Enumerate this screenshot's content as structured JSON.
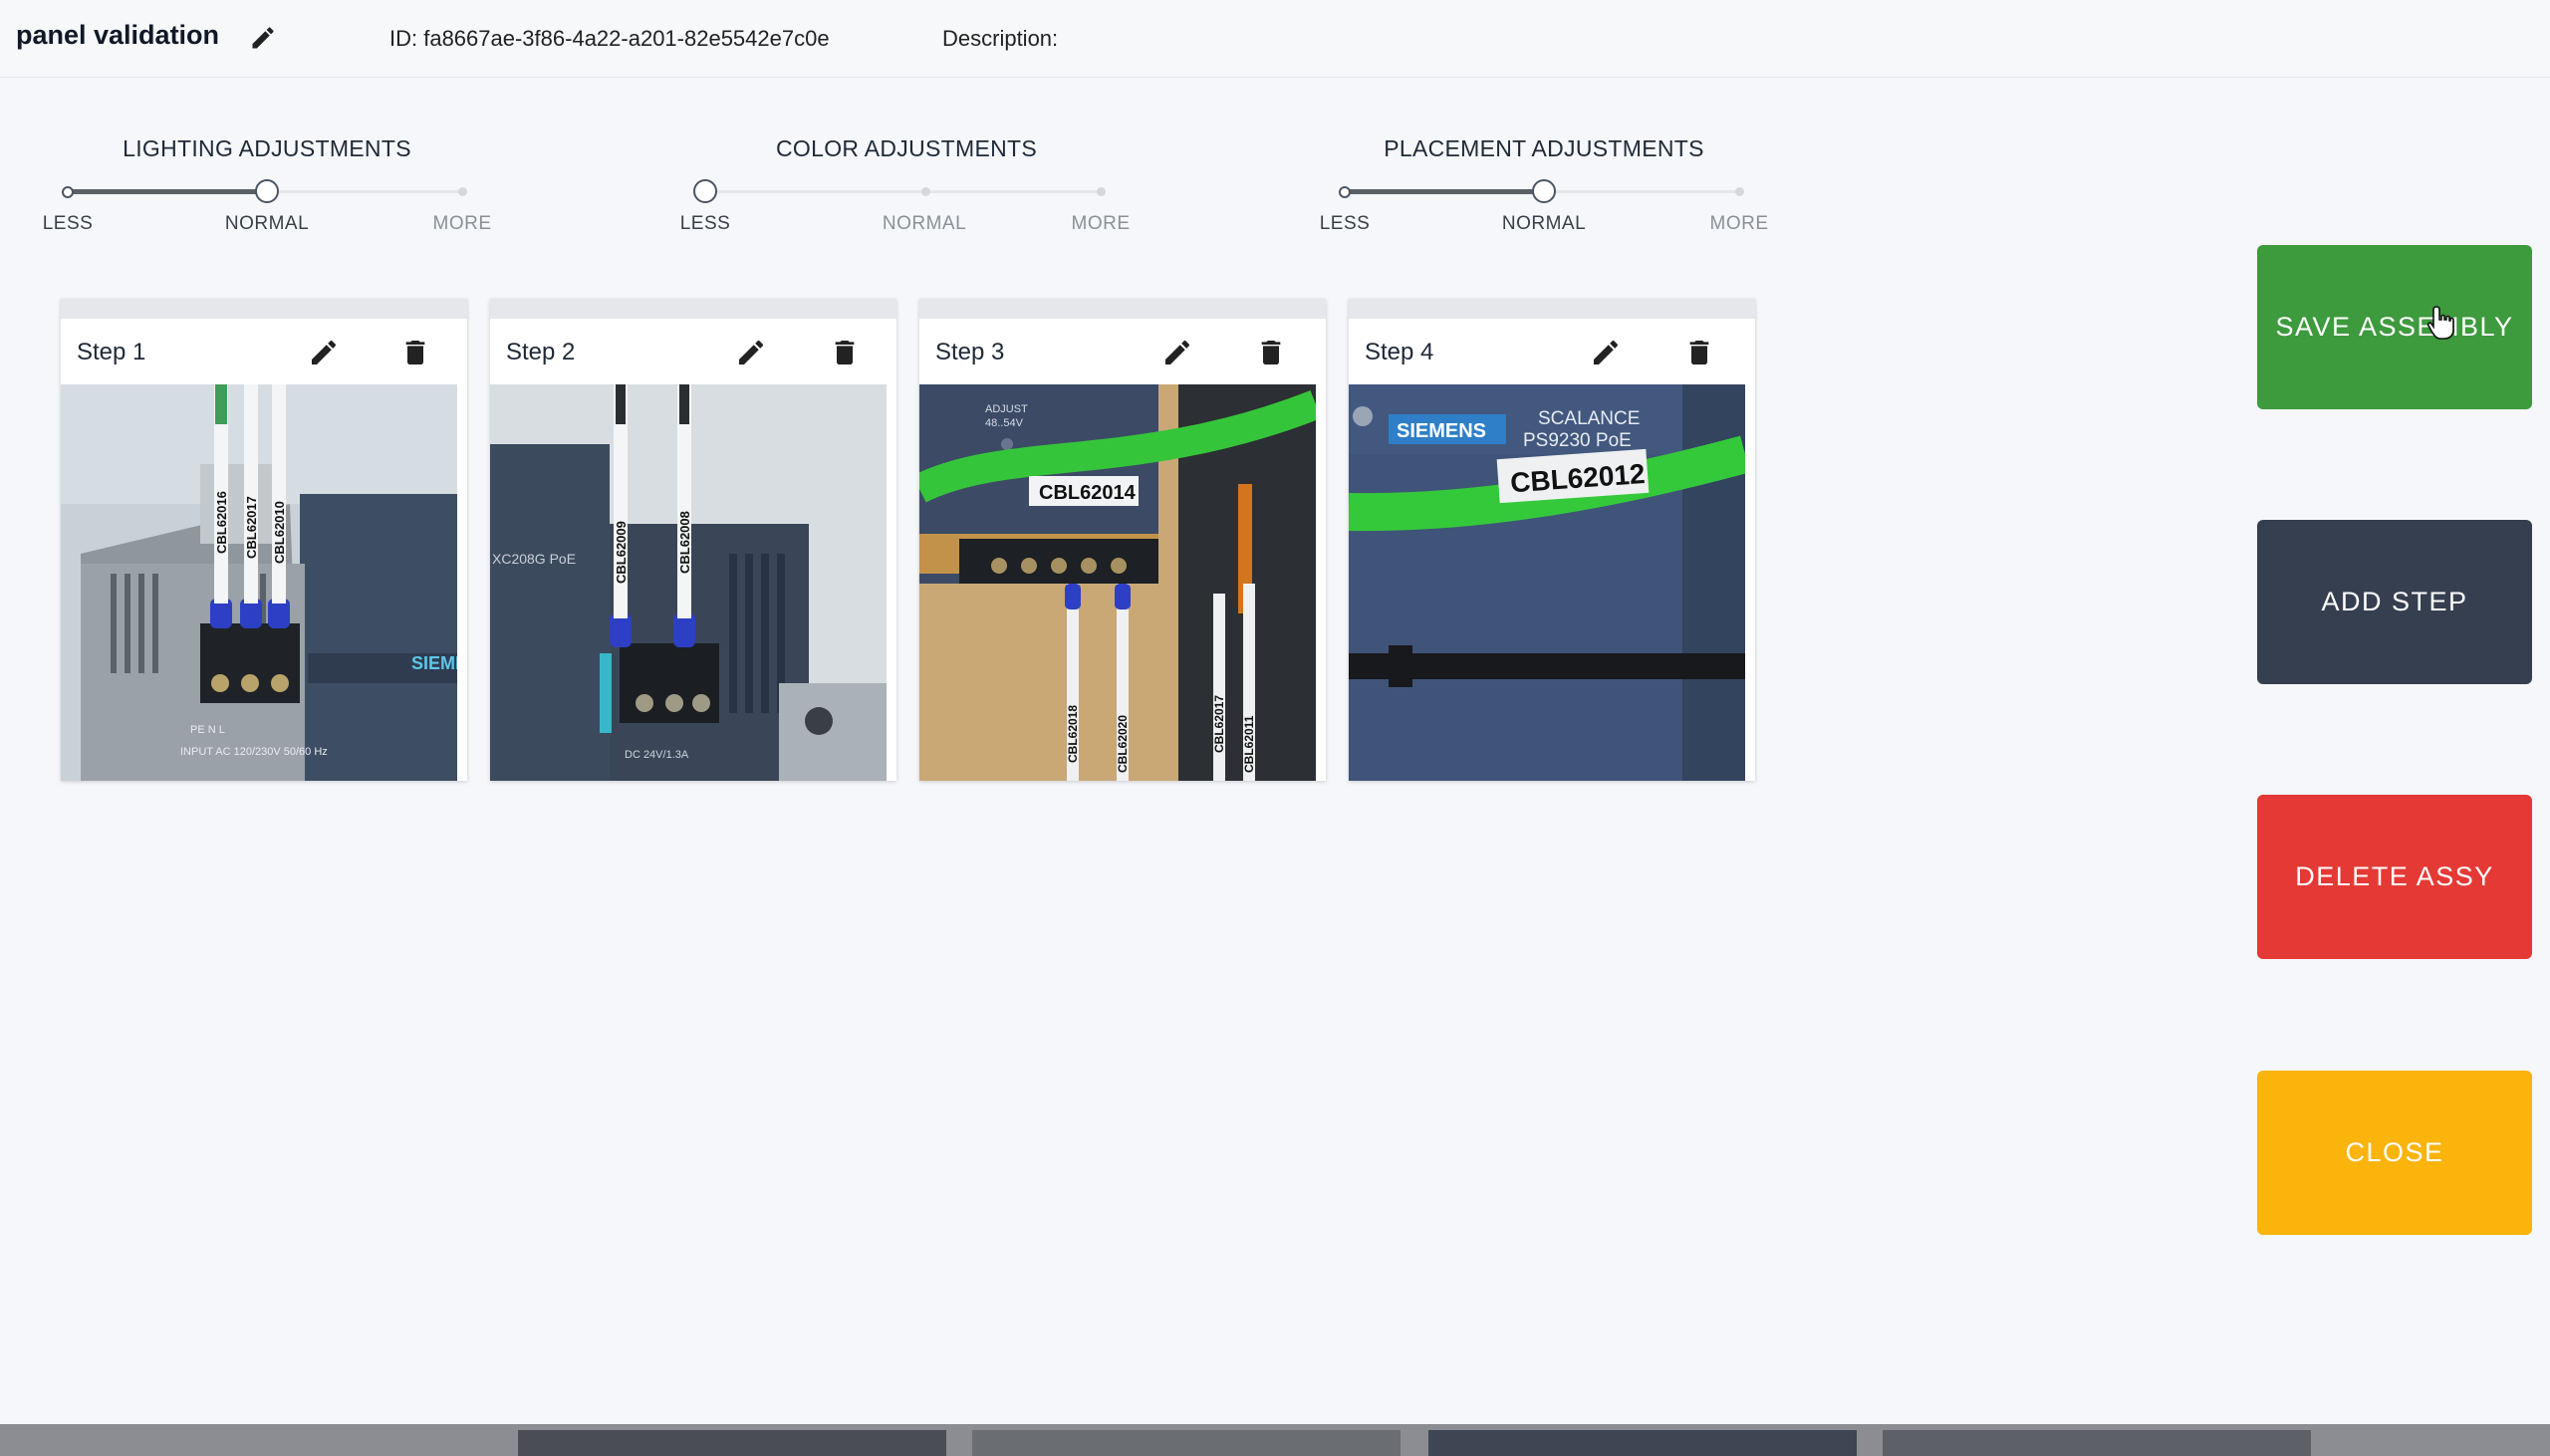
{
  "header": {
    "title": "panel validation",
    "id_text": "ID: fa8667ae-3f86-4a22-a201-82e5542e7c0e",
    "description_label": "Description:"
  },
  "adjustments": [
    {
      "title": "LIGHTING ADJUSTMENTS",
      "level": "NORMAL",
      "labels": [
        "LESS",
        "NORMAL",
        "MORE"
      ]
    },
    {
      "title": "COLOR ADJUSTMENTS",
      "level": "LESS",
      "labels": [
        "LESS",
        "NORMAL",
        "MORE"
      ]
    },
    {
      "title": "PLACEMENT ADJUSTMENTS",
      "level": "NORMAL",
      "labels": [
        "LESS",
        "NORMAL",
        "MORE"
      ]
    }
  ],
  "steps": [
    {
      "label": "Step 1",
      "cable_labels": [
        "CBL62016",
        "CBL62017",
        "CBL62010"
      ],
      "photo_text": [
        "INPUT AC 120/230V 50/60 Hz",
        "PE  N  L",
        "SIEME"
      ]
    },
    {
      "label": "Step 2",
      "cable_labels": [
        "CBL62009",
        "CBL62008"
      ],
      "photo_text": [
        "XC208G PoE",
        "DC 24V/1.3A"
      ]
    },
    {
      "label": "Step 3",
      "cable_labels": [
        "CBL62014",
        "CBL62018",
        "CBL62020",
        "CBL62017",
        "CBL62011"
      ],
      "photo_text": [
        "ADJUST",
        "48..54V"
      ]
    },
    {
      "label": "Step 4",
      "cable_labels": [
        "CBL62012"
      ],
      "photo_text": [
        "SIEMENS",
        "SCALANCE",
        "PS9230 PoE"
      ]
    }
  ],
  "buttons": {
    "save": "SAVE ASSEMBLY",
    "add_step": "ADD STEP",
    "delete": "DELETE ASSY",
    "close": "CLOSE"
  },
  "colors": {
    "save": "#3d9a3d",
    "add_step": "#353f50",
    "delete": "#e53935",
    "close": "#fbb40c"
  },
  "icons": {
    "edit": "pencil-icon",
    "delete": "trash-icon",
    "cursor": "hand-pointer-icon"
  }
}
